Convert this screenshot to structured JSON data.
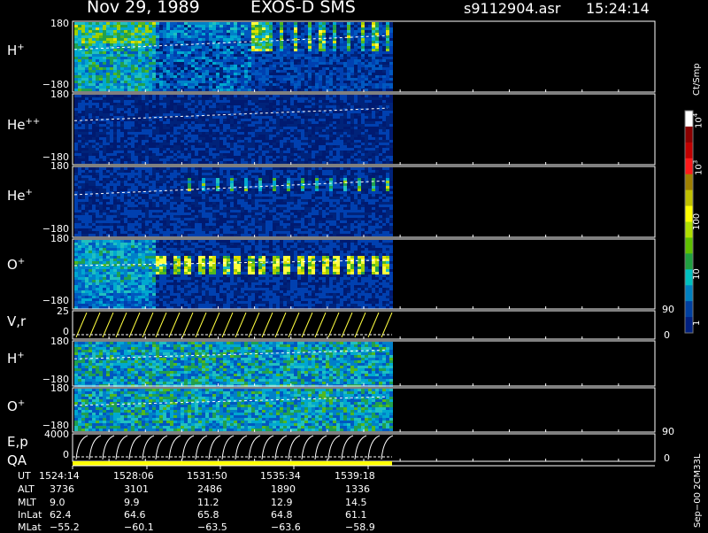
{
  "header": {
    "date": "Nov 29, 1989",
    "instrument": "EXOS-D SMS",
    "file": "s9112904.asr",
    "time": "15:24:14"
  },
  "panels": [
    {
      "species": "H",
      "charge": "+",
      "ymax": "180",
      "ymin": "−180"
    },
    {
      "species": "He",
      "charge": "++",
      "ymax": "180",
      "ymin": "−180"
    },
    {
      "species": "He",
      "charge": "+",
      "ymax": "180",
      "ymin": "−180"
    },
    {
      "species": "O",
      "charge": "+",
      "ymax": "180",
      "ymin": "−180"
    },
    {
      "species": "V,r",
      "charge": "",
      "ymax": "25",
      "ymin": "0",
      "rmax": "90",
      "rmin": "0"
    },
    {
      "species": "H",
      "charge": "+",
      "ymax": "180",
      "ymin": "−180"
    },
    {
      "species": "O",
      "charge": "+",
      "ymax": "180",
      "ymin": "−180"
    },
    {
      "species": "E,p",
      "charge": "",
      "ymax": "4000",
      "ymin": "0",
      "rmax": "90",
      "rmin": "0"
    }
  ],
  "qa_label": "QA",
  "colorbar": {
    "unit": "Ct/Smp",
    "ticks": [
      "10",
      "10",
      "100",
      "10",
      "1"
    ],
    "tick_exponents": [
      "4",
      "3",
      "",
      "",
      ""
    ],
    "colors": [
      "#ffffff",
      "#8b0000",
      "#c00000",
      "#ff1a1a",
      "#a08000",
      "#c0c000",
      "#ffff00",
      "#b0e000",
      "#60c000",
      "#20a040",
      "#00c0c0",
      "#0080c0",
      "#0040a0",
      "#002080"
    ]
  },
  "ephemeris": {
    "labels": [
      "UT",
      "ALT",
      "MLT",
      "InLat",
      "MLat"
    ],
    "columns": [
      {
        "UT": "1524:14",
        "ALT": "3736",
        "MLT": "9.0",
        "InLat": "62.4",
        "MLat": "−55.2"
      },
      {
        "UT": "1528:06",
        "ALT": "3101",
        "MLT": "9.9",
        "InLat": "64.6",
        "MLat": "−60.1"
      },
      {
        "UT": "1531:50",
        "ALT": "2486",
        "MLT": "11.2",
        "InLat": "65.8",
        "MLat": "−63.5"
      },
      {
        "UT": "1535:34",
        "ALT": "1890",
        "MLT": "12.9",
        "InLat": "64.8",
        "MLat": "−63.6"
      },
      {
        "UT": "1539:18",
        "ALT": "1336",
        "MLT": "14.5",
        "InLat": "61.1",
        "MLat": "−58.9"
      }
    ]
  },
  "footer_vertical": "Sep−00  2CM33L",
  "chart_data": {
    "type": "heatmap",
    "x_ticks": [
      "1524:14",
      "1528:06",
      "1531:50",
      "1535:34",
      "1539:18"
    ],
    "y_range_angle": [
      -180,
      180
    ],
    "color_scale": "log",
    "color_range": [
      1,
      10000
    ],
    "legend": "right"
  }
}
